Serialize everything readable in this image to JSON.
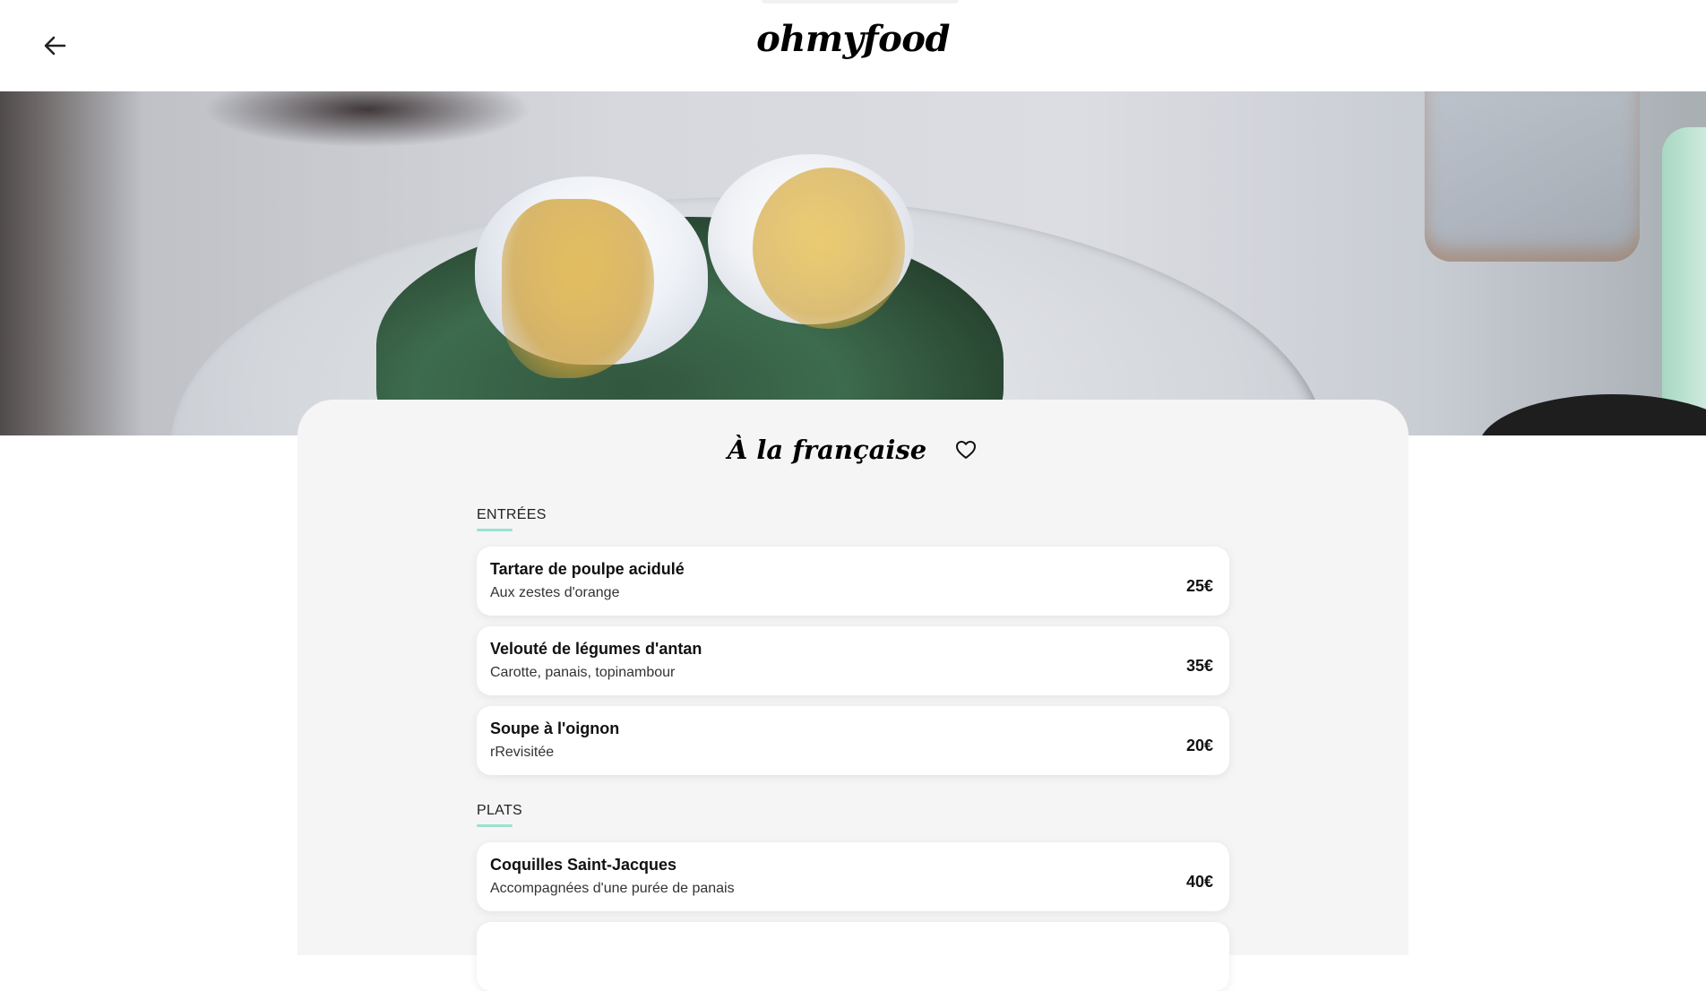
{
  "header": {
    "logo": "ohmyfood",
    "back_icon": "arrow-left-icon"
  },
  "hero": {
    "image_subject": "poached eggs with hollandaise on spinach"
  },
  "restaurant": {
    "name": "À la française",
    "like_icon": "heart-outline-icon"
  },
  "menu": {
    "sections": [
      {
        "heading": "ENTRÉES",
        "dishes": [
          {
            "name": "Tartare de poulpe acidulé",
            "description": "Aux zestes d'orange",
            "price": "25€"
          },
          {
            "name": "Velouté de légumes d'antan",
            "description": "Carotte, panais, topinambour",
            "price": "35€"
          },
          {
            "name": "Soupe à l'oignon",
            "description": "rRevisitée",
            "price": "20€"
          }
        ]
      },
      {
        "heading": "PLATS",
        "dishes": [
          {
            "name": "Coquilles Saint-Jacques",
            "description": "Accompagnées d'une purée de panais",
            "price": "40€"
          }
        ]
      }
    ]
  },
  "colors": {
    "accent": "#99e2d0",
    "card_background": "#f5f5f5",
    "dish_background": "#ffffff"
  }
}
